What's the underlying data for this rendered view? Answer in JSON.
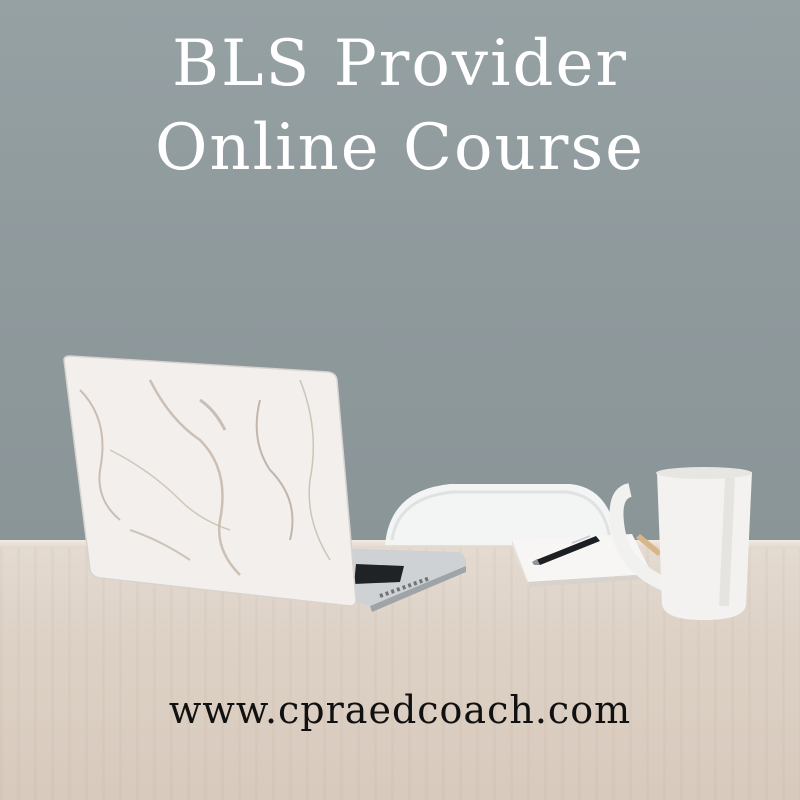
{
  "heading": {
    "line1": "BLS Provider",
    "line2": "Online Course"
  },
  "website": "www.cpraedcoach.com",
  "colors": {
    "wall": "#8f9a9d",
    "table": "#ddd1c5",
    "heading_text": "#ffffff",
    "website_text": "#111111"
  },
  "icons": [
    "marble-laptop",
    "white-chair",
    "notebook",
    "pen",
    "coffee-mug"
  ]
}
